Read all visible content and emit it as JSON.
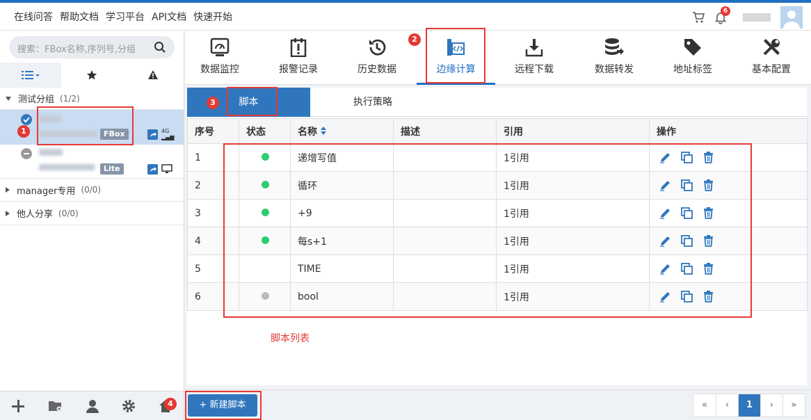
{
  "topnav": [
    "在线问答",
    "帮助文档",
    "学习平台",
    "API文档",
    "快速开始"
  ],
  "notifications": "6",
  "sidebar": {
    "search_placeholder": "搜索：FBox名称,序列号,分组",
    "groups": [
      {
        "name": "测试分组",
        "count": "(1/2)",
        "expanded": true
      },
      {
        "name": "manager专用",
        "count": "(0/0)",
        "expanded": false
      },
      {
        "name": "他人分享",
        "count": "(0/0)",
        "expanded": false
      }
    ],
    "devices": [
      {
        "type": "FBox",
        "network": "4G",
        "online": true
      },
      {
        "type": "Lite",
        "online": false
      }
    ]
  },
  "toolbar": [
    {
      "label": "数据监控",
      "icon": "monitor-icon"
    },
    {
      "label": "报警记录",
      "icon": "alarm-icon"
    },
    {
      "label": "历史数据",
      "icon": "history-icon"
    },
    {
      "label": "边缘计算",
      "icon": "code-icon",
      "active": true
    },
    {
      "label": "远程下载",
      "icon": "download-icon"
    },
    {
      "label": "数据转发",
      "icon": "database-icon"
    },
    {
      "label": "地址标签",
      "icon": "tag-icon"
    },
    {
      "label": "基本配置",
      "icon": "tools-icon"
    }
  ],
  "subtabs": [
    "脚本",
    "执行策略"
  ],
  "table": {
    "headers": [
      "序号",
      "状态",
      "名称",
      "描述",
      "引用",
      "操作"
    ],
    "rows": [
      {
        "no": "1",
        "status": "green",
        "name": "递增写值",
        "desc": "",
        "ref": "1引用"
      },
      {
        "no": "2",
        "status": "green",
        "name": "循环",
        "desc": "",
        "ref": "1引用"
      },
      {
        "no": "3",
        "status": "green",
        "name": "+9",
        "desc": "",
        "ref": "1引用"
      },
      {
        "no": "4",
        "status": "green",
        "name": "每s+1",
        "desc": "",
        "ref": "1引用"
      },
      {
        "no": "5",
        "status": "none",
        "name": "TIME",
        "desc": "",
        "ref": "1引用"
      },
      {
        "no": "6",
        "status": "gray",
        "name": "bool",
        "desc": "",
        "ref": "1引用"
      }
    ]
  },
  "annotation": "脚本列表",
  "markers": [
    "1",
    "2",
    "3",
    "4"
  ],
  "new_button": "+ 新建脚本",
  "pager": [
    "«",
    "‹",
    "1",
    "›",
    "»"
  ],
  "colors": {
    "accent": "#2f76bd",
    "online": "#2ecc71",
    "offline": "#bbbbbb",
    "marker": "#e53935"
  }
}
